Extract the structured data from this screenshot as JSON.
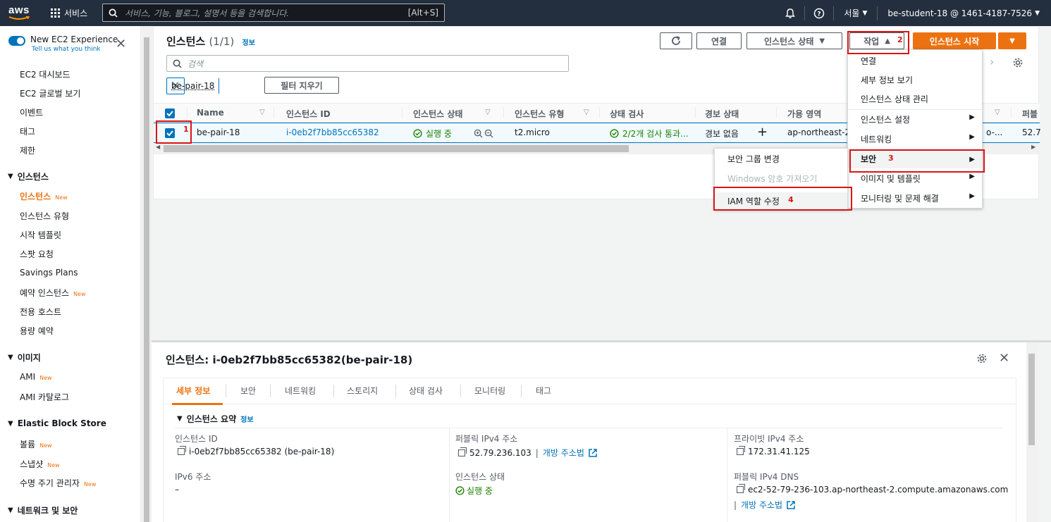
{
  "topnav": {
    "logo": "aws",
    "services": "서비스",
    "search_placeholder": "서비스, 기능, 블로그, 설명서 등을 검색합니다.",
    "search_shortcut": "[Alt+S]",
    "region": "서울",
    "account": "be-student-18 @ 1461-4187-7526"
  },
  "sidebar": {
    "new_experience": "New EC2 Experience",
    "tell_us": "Tell us what you think",
    "new_badge": "New",
    "items_top": [
      "EC2 대시보드",
      "EC2 글로벌 보기",
      "이벤트",
      "태그",
      "제한"
    ],
    "section_instances": "인스턴스",
    "instances_items": [
      "인스턴스",
      "인스턴스 유형",
      "시작 템플릿",
      "스팟 요청",
      "Savings Plans",
      "예약 인스턴스",
      "전용 호스트",
      "용량 예약"
    ],
    "section_images": "이미지",
    "images_items": [
      "AMI",
      "AMI 카탈로그"
    ],
    "section_ebs": "Elastic Block Store",
    "ebs_items": [
      "볼륨",
      "스냅샷",
      "수명 주기 관리자"
    ],
    "section_network": "네트워크 및 보안"
  },
  "list": {
    "title": "인스턴스",
    "count": "(1/1)",
    "info": "정보",
    "btn_connect": "연결",
    "btn_state": "인스턴스 상태",
    "btn_actions": "작업",
    "btn_launch": "인스턴스 시작",
    "search_placeholder": "검색",
    "filter_token": "be-pair-18",
    "btn_clear": "필터 지우기",
    "columns": [
      "Name",
      "인스턴스 ID",
      "인스턴스 상태",
      "인스턴스 유형",
      "상태 검사",
      "경보 상태",
      "가용 영역",
      "퍼블"
    ],
    "row": {
      "name": "be-pair-18",
      "id": "i-0eb2f7bb85cc65382",
      "state": "실행 중",
      "type": "t2.micro",
      "check": "2/2개 검사 통과...",
      "alarm": "경보 없음",
      "az": "ap-northeast-2",
      "dns_trunc": "o-...",
      "public_ip_trunc": "52.7"
    }
  },
  "actions_menu": {
    "items": [
      "연결",
      "세부 정보 보기",
      "인스턴스 상태 관리",
      "인스턴스 설정",
      "네트워킹",
      "보안",
      "이미지 및 템플릿",
      "모니터링 및 문제 해결"
    ]
  },
  "security_submenu": {
    "items": [
      "보안 그룹 변경",
      "Windows 암호 가져오기",
      "IAM 역할 수정"
    ]
  },
  "annotations": [
    "1",
    "2",
    "3",
    "4"
  ],
  "details": {
    "title_prefix": "인스턴스:",
    "title_value": "i-0eb2f7bb85cc65382(be-pair-18)",
    "tabs": [
      "세부 정보",
      "보안",
      "네트워킹",
      "스토리지",
      "상태 검사",
      "모니터링",
      "태그"
    ],
    "summary_heading": "인스턴스 요약",
    "summary_info": "정보",
    "instance_id_label": "인스턴스 ID",
    "instance_id_value": "i-0eb2f7bb85cc65382 (be-pair-18)",
    "ipv6_label": "IPv6 주소",
    "ipv6_value": "–",
    "public_ipv4_label": "퍼블릭 IPv4 주소",
    "public_ipv4_value": "52.79.236.103",
    "open_address": "개방 주소법",
    "state_label": "인스턴스 상태",
    "state_value": "실행 중",
    "private_ipv4_label": "프라이빗 IPv4 주소",
    "private_ipv4_value": "172.31.41.125",
    "public_dns_label": "퍼블릭 IPv4 DNS",
    "public_dns_value": "ec2-52-79-236-103.ap-northeast-2.compute.amazonaws.com"
  },
  "colors": {
    "nav_bg": "#232f3e",
    "accent": "#ec7211",
    "link": "#0073bb",
    "success": "#1d8102",
    "annotation": "#d91515"
  }
}
